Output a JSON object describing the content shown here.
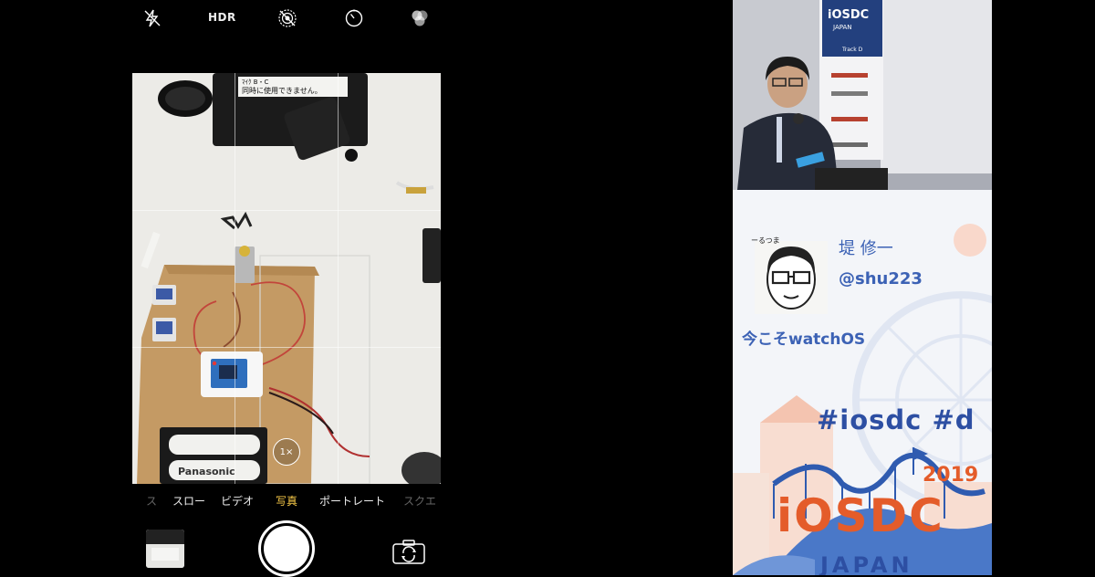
{
  "camera": {
    "top_bar": {
      "flash_icon": "flash-off-icon",
      "hdr_label": "HDR",
      "live_icon": "live-photo-off-icon",
      "timer_icon": "timer-icon",
      "filters_icon": "filters-icon"
    },
    "zoom_label": "1×",
    "modes": [
      {
        "label": "タイムラプス",
        "visible": "ス"
      },
      {
        "label": "スロー"
      },
      {
        "label": "ビデオ"
      },
      {
        "label": "写真",
        "active": true
      },
      {
        "label": "ポートレート"
      },
      {
        "label": "スクエア",
        "visible": "スクエ"
      }
    ],
    "accent_color": "#f7c948",
    "scene_text": {
      "sign_line1": "ﾏｲｸ B・C",
      "sign_line2": "同時に使用できません。",
      "battery_brand": "Panasonic"
    }
  },
  "slide": {
    "speaker_caption": "ーるつま",
    "speaker_name": "堤 修一",
    "speaker_handle": "@shu223",
    "talk_title": "今こそwatchOS",
    "hashtag": "#iosdc #d",
    "year": "2019",
    "logo_main": "iOSDC",
    "logo_sub": "JAPAN",
    "video": {
      "banner_title": "iOSDC",
      "banner_sub": "JAPAN",
      "banner_track": "Track D"
    },
    "colors": {
      "primary_blue": "#3c62b5",
      "accent_orange": "#e45c2a"
    }
  }
}
